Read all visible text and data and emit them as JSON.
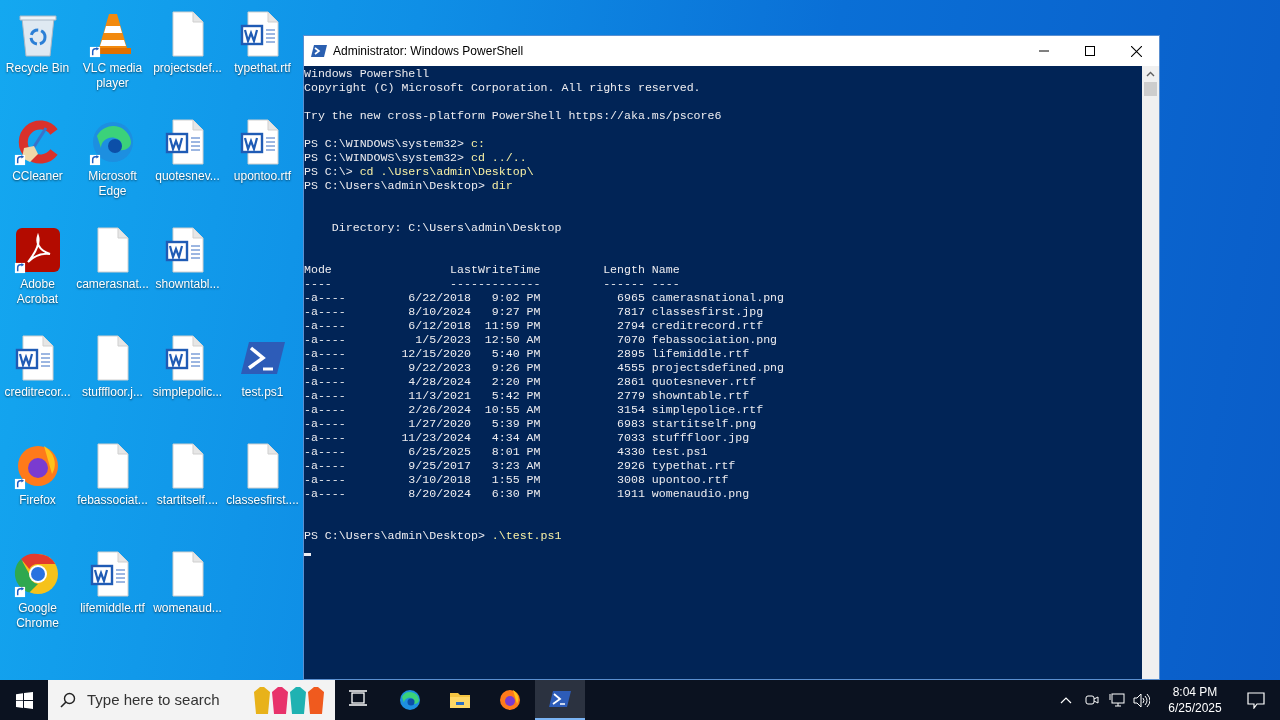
{
  "desktop": {
    "icon_rows": [
      [
        {
          "label": "Recycle Bin",
          "kind": "recycle",
          "shortcut": false
        },
        {
          "label": "VLC media player",
          "kind": "vlc",
          "shortcut": true
        },
        {
          "label": "projectsdef...",
          "kind": "blank",
          "shortcut": false
        },
        {
          "label": "typethat.rtf",
          "kind": "word",
          "shortcut": false
        }
      ],
      [
        {
          "label": "CCleaner",
          "kind": "ccleaner",
          "shortcut": true
        },
        {
          "label": "Microsoft Edge",
          "kind": "edge",
          "shortcut": true
        },
        {
          "label": "quotesnev...",
          "kind": "word",
          "shortcut": false
        },
        {
          "label": "upontoo.rtf",
          "kind": "word",
          "shortcut": false
        }
      ],
      [
        {
          "label": "Adobe Acrobat",
          "kind": "pdf",
          "shortcut": true
        },
        {
          "label": "camerasnat...",
          "kind": "blank",
          "shortcut": false
        },
        {
          "label": "showntabl...",
          "kind": "word",
          "shortcut": false
        }
      ],
      [
        {
          "label": "creditrecor...",
          "kind": "word",
          "shortcut": false
        },
        {
          "label": "stufffloor.j...",
          "kind": "blank",
          "shortcut": false
        },
        {
          "label": "simplepolic...",
          "kind": "word",
          "shortcut": false
        },
        {
          "label": "test.ps1",
          "kind": "powershell",
          "shortcut": false
        }
      ],
      [
        {
          "label": "Firefox",
          "kind": "firefox",
          "shortcut": true
        },
        {
          "label": "febassociat...",
          "kind": "blank",
          "shortcut": false
        },
        {
          "label": "startitself....",
          "kind": "blank",
          "shortcut": false
        },
        {
          "label": "classesfirst....",
          "kind": "blank",
          "shortcut": false
        }
      ],
      [
        {
          "label": "Google Chrome",
          "kind": "chrome",
          "shortcut": true
        },
        {
          "label": "lifemiddle.rtf",
          "kind": "word",
          "shortcut": false
        },
        {
          "label": "womenaud...",
          "kind": "blank",
          "shortcut": false
        }
      ]
    ]
  },
  "window": {
    "title": "Administrator: Windows PowerShell",
    "lines": [
      {
        "kind": "text",
        "text": "Windows PowerShell"
      },
      {
        "kind": "text",
        "text": "Copyright (C) Microsoft Corporation. All rights reserved."
      },
      {
        "kind": "blank"
      },
      {
        "kind": "text",
        "text": "Try the new cross-platform PowerShell https://aka.ms/pscore6"
      },
      {
        "kind": "blank"
      },
      {
        "kind": "command",
        "prompt": "PS C:\\WINDOWS\\system32>",
        "command": "c:"
      },
      {
        "kind": "command",
        "prompt": "PS C:\\WINDOWS\\system32>",
        "command": "cd ../.."
      },
      {
        "kind": "command",
        "prompt": "PS C:\\>",
        "command": "cd .\\Users\\admin\\Desktop\\"
      },
      {
        "kind": "command",
        "prompt": "PS C:\\Users\\admin\\Desktop>",
        "command": "dir"
      },
      {
        "kind": "blank"
      },
      {
        "kind": "blank"
      },
      {
        "kind": "heading",
        "text": "Directory: C:\\Users\\admin\\Desktop"
      },
      {
        "kind": "blank"
      },
      {
        "kind": "blank"
      },
      {
        "kind": "listing",
        "columns": [
          "Mode",
          "LastWriteTime",
          "Length",
          "Name"
        ],
        "rules": [
          "----",
          "-------------",
          "------",
          "----"
        ],
        "rows": [
          {
            "mode": "-a----",
            "date": "6/22/2018",
            "time": "9:02 PM",
            "length": "6965",
            "name": "camerasnational.png"
          },
          {
            "mode": "-a----",
            "date": "8/10/2024",
            "time": "9:27 PM",
            "length": "7817",
            "name": "classesfirst.jpg"
          },
          {
            "mode": "-a----",
            "date": "6/12/2018",
            "time": "11:59 PM",
            "length": "2794",
            "name": "creditrecord.rtf"
          },
          {
            "mode": "-a----",
            "date": "1/5/2023",
            "time": "12:50 AM",
            "length": "7070",
            "name": "febassociation.png"
          },
          {
            "mode": "-a----",
            "date": "12/15/2020",
            "time": "5:40 PM",
            "length": "2895",
            "name": "lifemiddle.rtf"
          },
          {
            "mode": "-a----",
            "date": "9/22/2023",
            "time": "9:26 PM",
            "length": "4555",
            "name": "projectsdefined.png"
          },
          {
            "mode": "-a----",
            "date": "4/28/2024",
            "time": "2:20 PM",
            "length": "2861",
            "name": "quotesnever.rtf"
          },
          {
            "mode": "-a----",
            "date": "11/3/2021",
            "time": "5:42 PM",
            "length": "2779",
            "name": "showntable.rtf"
          },
          {
            "mode": "-a----",
            "date": "2/26/2024",
            "time": "10:55 AM",
            "length": "3154",
            "name": "simplepolice.rtf"
          },
          {
            "mode": "-a----",
            "date": "1/27/2020",
            "time": "5:39 PM",
            "length": "6983",
            "name": "startitself.png"
          },
          {
            "mode": "-a----",
            "date": "11/23/2024",
            "time": "4:34 AM",
            "length": "7033",
            "name": "stufffloor.jpg"
          },
          {
            "mode": "-a----",
            "date": "6/25/2025",
            "time": "8:01 PM",
            "length": "4330",
            "name": "test.ps1"
          },
          {
            "mode": "-a----",
            "date": "9/25/2017",
            "time": "3:23 AM",
            "length": "2926",
            "name": "typethat.rtf"
          },
          {
            "mode": "-a----",
            "date": "3/10/2018",
            "time": "1:55 PM",
            "length": "3008",
            "name": "upontoo.rtf"
          },
          {
            "mode": "-a----",
            "date": "8/20/2024",
            "time": "6:30 PM",
            "length": "1911",
            "name": "womenaudio.png"
          }
        ]
      },
      {
        "kind": "blank"
      },
      {
        "kind": "blank"
      },
      {
        "kind": "command",
        "prompt": "PS C:\\Users\\admin\\Desktop>",
        "command": ".\\test.ps1"
      },
      {
        "kind": "cursor"
      }
    ]
  },
  "taskbar": {
    "search": {
      "placeholder": "Type here to search"
    },
    "apps": [
      {
        "kind": "taskview",
        "selected": false
      },
      {
        "kind": "edge",
        "selected": false
      },
      {
        "kind": "explorer",
        "selected": false
      },
      {
        "kind": "firefox",
        "selected": false
      },
      {
        "kind": "powershell",
        "selected": true
      }
    ],
    "time": "8:04 PM",
    "date": "6/25/2025"
  }
}
